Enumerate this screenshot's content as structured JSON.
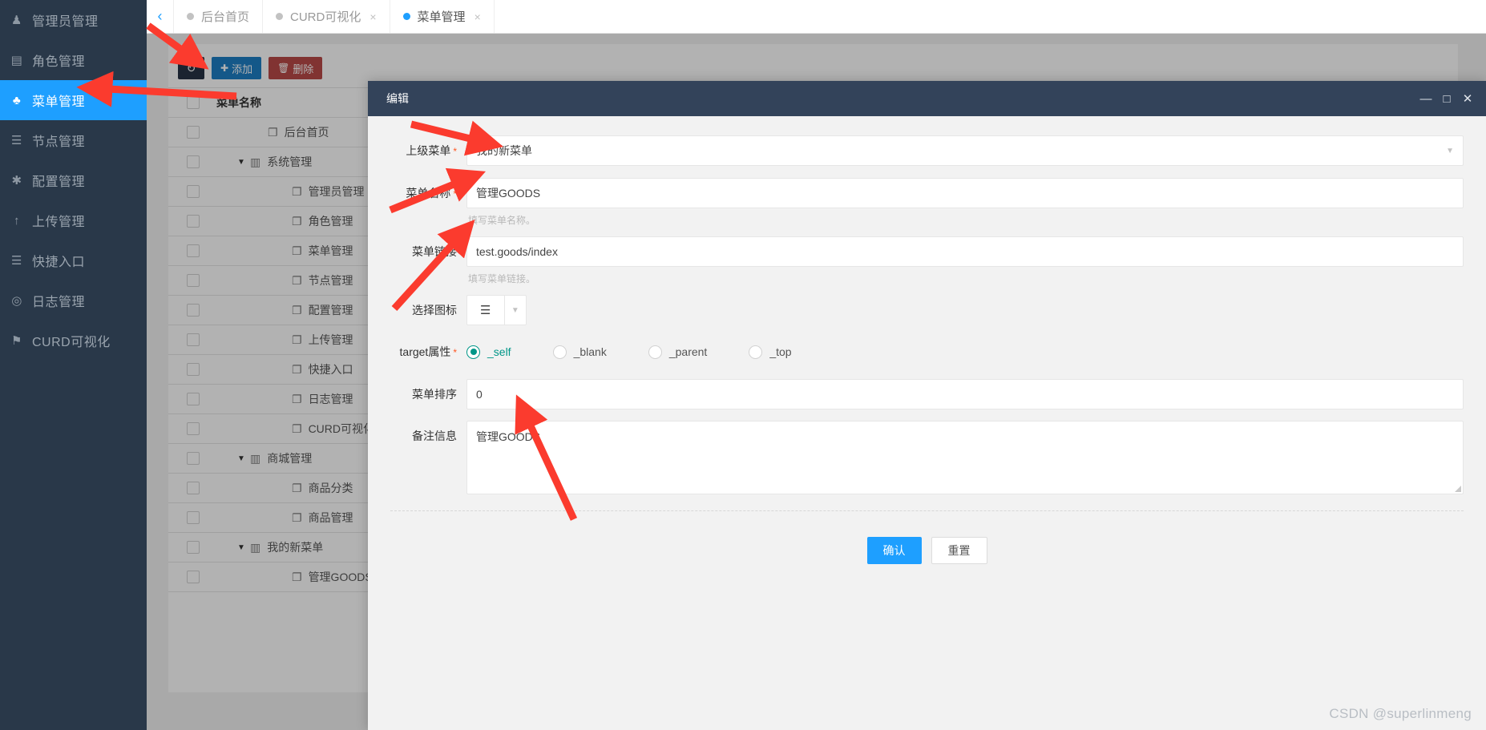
{
  "sidebar": {
    "items": [
      {
        "label": "管理员管理",
        "icon": "user-icon",
        "active": false
      },
      {
        "label": "角色管理",
        "icon": "id-card-icon",
        "active": false
      },
      {
        "label": "菜单管理",
        "icon": "tree-icon",
        "active": true
      },
      {
        "label": "节点管理",
        "icon": "list-icon",
        "active": false
      },
      {
        "label": "配置管理",
        "icon": "asterisk-icon",
        "active": false
      },
      {
        "label": "上传管理",
        "icon": "upload-arrow-icon",
        "active": false
      },
      {
        "label": "快捷入口",
        "icon": "list-icon",
        "active": false
      },
      {
        "label": "日志管理",
        "icon": "log-icon",
        "active": false
      },
      {
        "label": "CURD可视化",
        "icon": "flag-icon",
        "active": false
      }
    ]
  },
  "tabbar": {
    "back_arrow": "‹",
    "tabs": [
      {
        "label": "后台首页",
        "active": false,
        "closable": false
      },
      {
        "label": "CURD可视化",
        "active": false,
        "closable": true
      },
      {
        "label": "菜单管理",
        "active": true,
        "closable": true
      }
    ],
    "close_glyph": "×"
  },
  "toolbar": {
    "refresh_label": "↻",
    "add_label": "添加",
    "add_icon": "plus-icon",
    "delete_label": "删除",
    "delete_icon": "trash-icon"
  },
  "table": {
    "header": [
      "菜单名称"
    ],
    "rows": [
      {
        "name": "后台首页",
        "level": 1,
        "expandable": false,
        "icon": "file-icon"
      },
      {
        "name": "系统管理",
        "level": 0,
        "expandable": true,
        "icon": "folder-icon"
      },
      {
        "name": "管理员管理",
        "level": 2,
        "expandable": false,
        "icon": "file-icon"
      },
      {
        "name": "角色管理",
        "level": 2,
        "expandable": false,
        "icon": "file-icon"
      },
      {
        "name": "菜单管理",
        "level": 2,
        "expandable": false,
        "icon": "file-icon"
      },
      {
        "name": "节点管理",
        "level": 2,
        "expandable": false,
        "icon": "file-icon"
      },
      {
        "name": "配置管理",
        "level": 2,
        "expandable": false,
        "icon": "file-icon"
      },
      {
        "name": "上传管理",
        "level": 2,
        "expandable": false,
        "icon": "file-icon"
      },
      {
        "name": "快捷入口",
        "level": 2,
        "expandable": false,
        "icon": "file-icon"
      },
      {
        "name": "日志管理",
        "level": 2,
        "expandable": false,
        "icon": "file-icon"
      },
      {
        "name": "CURD可视化",
        "level": 2,
        "expandable": false,
        "icon": "file-icon"
      },
      {
        "name": "商城管理",
        "level": 0,
        "expandable": true,
        "icon": "folder-icon"
      },
      {
        "name": "商品分类",
        "level": 2,
        "expandable": false,
        "icon": "file-icon"
      },
      {
        "name": "商品管理",
        "level": 2,
        "expandable": false,
        "icon": "file-icon"
      },
      {
        "name": "我的新菜单",
        "level": 0,
        "expandable": true,
        "icon": "folder-icon"
      },
      {
        "name": "管理GOODS",
        "level": 2,
        "expandable": false,
        "icon": "file-icon"
      }
    ]
  },
  "dialog": {
    "title": "编辑",
    "window_controls": {
      "minimize": "—",
      "maximize": "□",
      "close": "✕"
    },
    "fields": {
      "parent_menu": {
        "label": "上级菜单",
        "required": true,
        "value": "我的新菜单"
      },
      "menu_name": {
        "label": "菜单名称",
        "required": true,
        "value": "管理GOODS",
        "hint": "填写菜单名称。"
      },
      "menu_link": {
        "label": "菜单链接",
        "required": false,
        "value": "test.goods/index",
        "hint": "填写菜单链接。"
      },
      "icon_select": {
        "label": "选择图标",
        "required": false,
        "icon": "list-icon"
      },
      "target": {
        "label": "target属性",
        "required": true,
        "options": [
          "_self",
          "_blank",
          "_parent",
          "_top"
        ],
        "selected": "_self"
      },
      "menu_sort": {
        "label": "菜单排序",
        "required": false,
        "value": "0"
      },
      "remark": {
        "label": "备注信息",
        "required": false,
        "value": "管理GOODS"
      }
    },
    "footer": {
      "confirm_label": "确认",
      "reset_label": "重置"
    }
  },
  "watermark": "CSDN @superlinmeng",
  "colors": {
    "sidebar_bg": "#293849",
    "accent_blue": "#1e9fff",
    "dialog_header": "#33435a",
    "radio_green": "#009688",
    "delete_red": "#b94a48",
    "arrow_red": "#fb3b2e"
  }
}
